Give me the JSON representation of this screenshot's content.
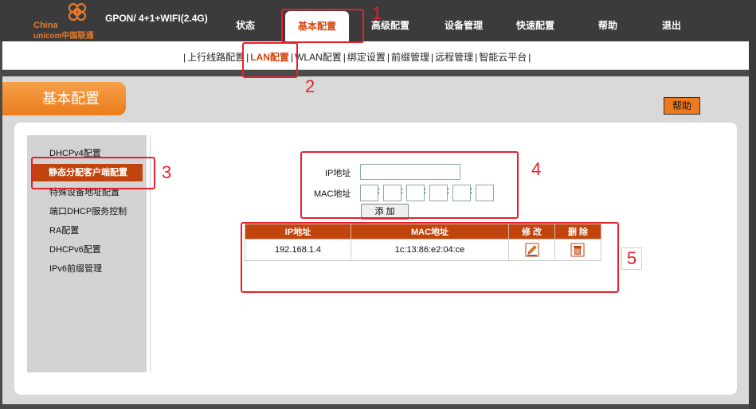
{
  "brand": {
    "logo_line1": "China",
    "logo_line2": "unicom中国联通",
    "model": "GPON/ 4+1+WIFI(2.4G)"
  },
  "nav": [
    "状态",
    "基本配置",
    "高级配置",
    "设备管理",
    "快速配置",
    "帮助",
    "退出"
  ],
  "subnav": [
    "上行线路配置",
    "LAN配置",
    "WLAN配置",
    "绑定设置",
    "前缀管理",
    "远程管理",
    "智能云平台"
  ],
  "section": {
    "title": "基本配置",
    "help": "帮助"
  },
  "sidebar": [
    "DHCPv4配置",
    "静态分配客户端配置",
    "特殊设备地址配置",
    "端口DHCP服务控制",
    "RA配置",
    "DHCPv6配置",
    "IPv6前缀管理"
  ],
  "form": {
    "ip_label": "IP地址",
    "mac_label": "MAC地址",
    "ip_value": "",
    "mac_values": [
      "",
      "",
      "",
      "",
      "",
      ""
    ],
    "add_label": "添 加"
  },
  "table": {
    "headers": [
      "IP地址",
      "MAC地址",
      "修 改",
      "删 除"
    ],
    "rows": [
      {
        "ip": "192.168.1.4",
        "mac": "1c:13:86:e2:04:ce"
      }
    ]
  },
  "annotations": [
    "1",
    "2",
    "3",
    "4",
    "5"
  ],
  "colors": {
    "accent": "#d1470e",
    "header_red": "#c1440e",
    "annotation": "#e8202e",
    "orange": "#ea7c1c"
  }
}
